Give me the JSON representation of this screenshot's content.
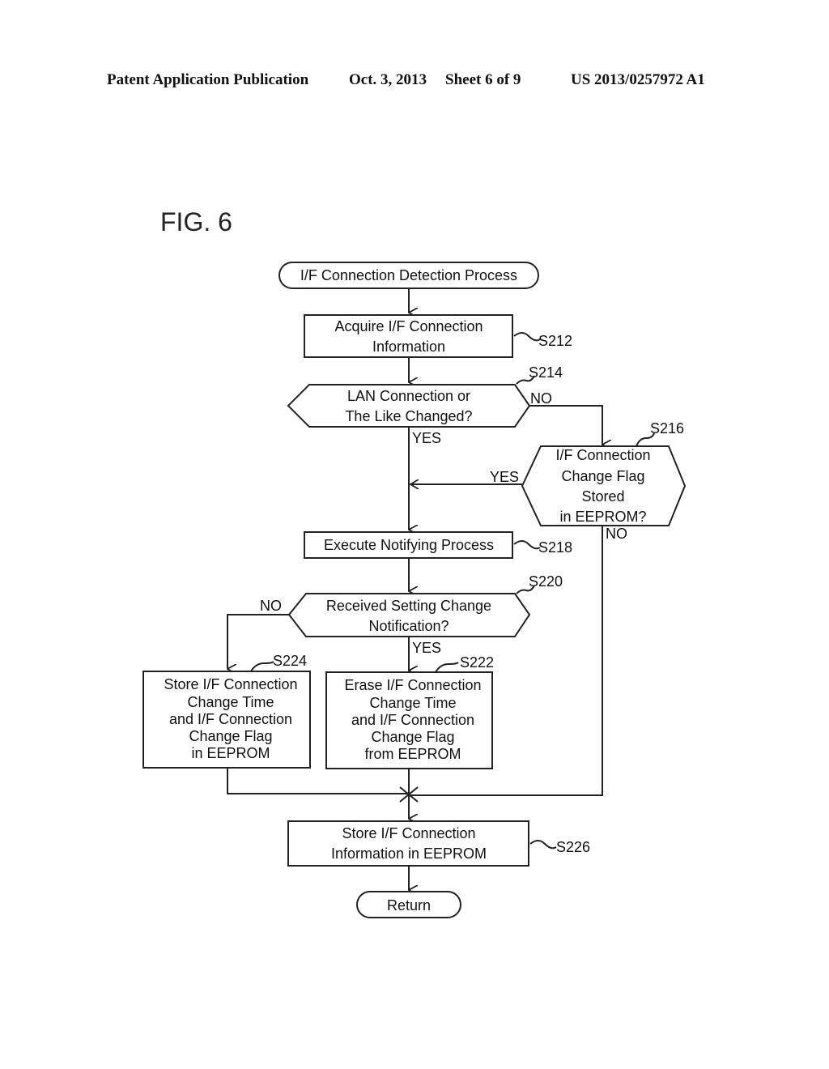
{
  "header": {
    "publication": "Patent Application Publication",
    "date": "Oct. 3, 2013",
    "sheet": "Sheet 6 of 9",
    "number": "US 2013/0257972 A1"
  },
  "figure": {
    "title": "FIG. 6",
    "start": "I/F Connection Detection Process",
    "end": "Return",
    "steps": {
      "s212": {
        "id": "S212",
        "lines": [
          "Acquire I/F Connection",
          "Information"
        ]
      },
      "s214": {
        "id": "S214",
        "lines": [
          "LAN Connection or",
          "The Like Changed?"
        ],
        "no": "NO",
        "yes": "YES"
      },
      "s216": {
        "id": "S216",
        "lines": [
          "I/F Connection",
          "Change Flag",
          "Stored",
          "in EEPROM?"
        ],
        "yes": "YES",
        "no": "NO"
      },
      "s218": {
        "id": "S218",
        "lines": [
          "Execute Notifying Process"
        ]
      },
      "s220": {
        "id": "S220",
        "lines": [
          "Received Setting Change",
          "Notification?"
        ],
        "no": "NO",
        "yes": "YES"
      },
      "s222": {
        "id": "S222",
        "lines": [
          "Erase I/F Connection",
          "Change Time",
          "and I/F Connection",
          "Change Flag",
          "from EEPROM"
        ]
      },
      "s224": {
        "id": "S224",
        "lines": [
          "Store I/F Connection",
          "Change Time",
          "and I/F Connection",
          "Change Flag",
          "in EEPROM"
        ]
      },
      "s226": {
        "id": "S226",
        "lines": [
          "Store I/F Connection",
          "Information in EEPROM"
        ]
      }
    }
  }
}
